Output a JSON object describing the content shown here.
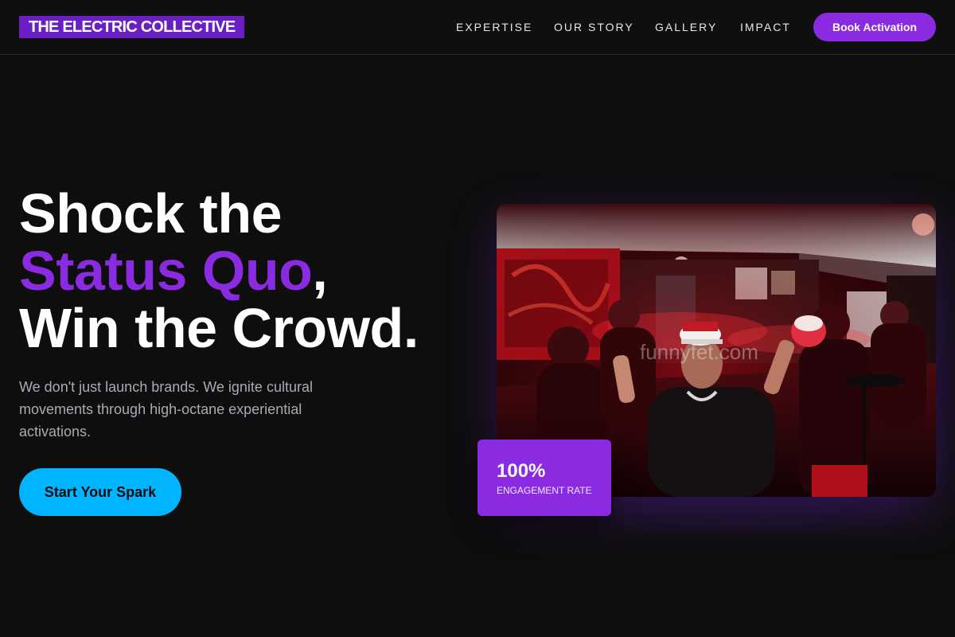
{
  "brand": {
    "logo_text": "THE ELECTRIC COLLECTIVE"
  },
  "nav": {
    "items": [
      {
        "label": "EXPERTISE"
      },
      {
        "label": "OUR STORY"
      },
      {
        "label": "GALLERY"
      },
      {
        "label": "IMPACT"
      }
    ],
    "cta_label": "Book Activation"
  },
  "hero": {
    "headline_line1": "Shock the",
    "headline_accent": "Status Quo",
    "headline_comma": ",",
    "headline_line3": "Win the Crowd.",
    "subtext": "We don't just launch brands. We ignite cultural movements through high-octane experiential activations.",
    "cta_label": "Start Your Spark"
  },
  "stat": {
    "value": "100%",
    "label": "ENGAGEMENT RATE"
  },
  "photo": {
    "watermark": "funnyfet.com"
  },
  "colors": {
    "background": "#0e0e0e",
    "accent_purple": "#8a2be2",
    "accent_cyan": "#00b4ff",
    "muted_text": "#a9aab5"
  }
}
